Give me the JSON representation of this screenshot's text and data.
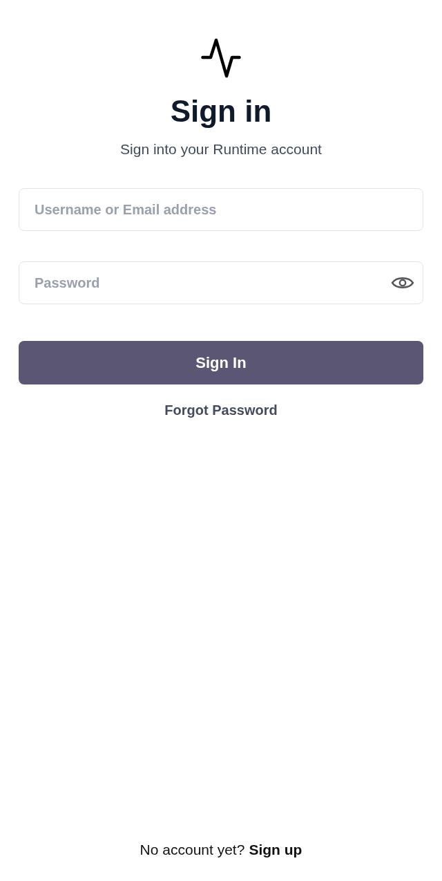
{
  "header": {
    "title": "Sign in",
    "subtitle": "Sign into your Runtime account"
  },
  "form": {
    "fields": [
      {
        "kind": "text",
        "placeholder": "Username or Email address"
      },
      {
        "kind": "password",
        "placeholder": "Password"
      }
    ],
    "submit": "Sign In",
    "forgot_link": "Forgot Password"
  },
  "footer": {
    "prompt": "No account yet?",
    "link": "Sign up"
  }
}
